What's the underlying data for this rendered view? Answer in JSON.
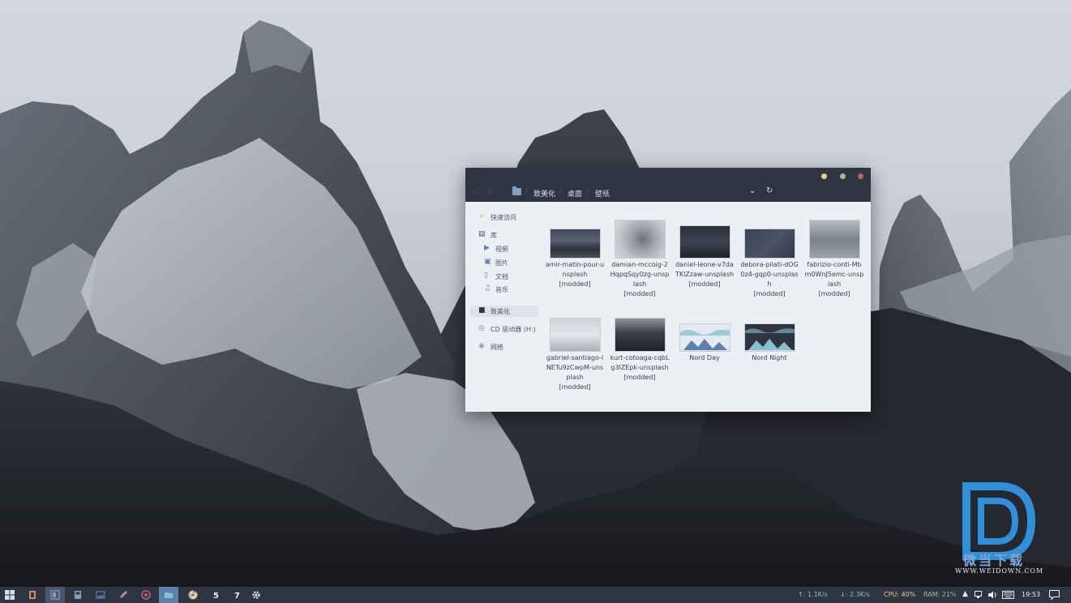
{
  "window": {
    "breadcrumb": [
      "致美化",
      "桌面",
      "壁纸"
    ]
  },
  "sidebar": {
    "quick_access": "快速访问",
    "library": "库",
    "videos": "视频",
    "pictures": "图片",
    "documents": "文档",
    "music": "音乐",
    "this_pc": "致美化",
    "cd_drive": "CD 驱动器 (H:)",
    "network": "网络"
  },
  "files": [
    {
      "name": "amir-matin-pour-unsplash",
      "tag": "[modded]"
    },
    {
      "name": "damian-mccoig-2HqpqSqy0zg-unsplash",
      "tag": "[modded]"
    },
    {
      "name": "daniel-leone-v7daTKlZzaw-unsplash",
      "tag": "[modded]"
    },
    {
      "name": "debora-pilati-dOG0z4-gqp0-unsplash",
      "tag": "[modded]"
    },
    {
      "name": "fabrizio-conti-Mbm0WnJ5emc-unsplash",
      "tag": "[modded]"
    },
    {
      "name": "gabriel-santiago-lNETu9zCwpM-unsplash",
      "tag": "[modded]"
    },
    {
      "name": "kurt-cotoaga-cqbLg3lZEpk-unsplash",
      "tag": "[modded]"
    },
    {
      "name": "Nord Day",
      "tag": ""
    },
    {
      "name": "Nord Night",
      "tag": ""
    }
  ],
  "taskbar": {
    "upload": "↑: 1.1K/s",
    "download": "↓: 2.3K/s",
    "cpu": "CPU: 40%",
    "ram": "RAM: 21%",
    "clock": "19:53",
    "app_icons": [
      "windows-start",
      "office",
      "file-manager",
      "save",
      "image-viewer",
      "pen",
      "netease-music",
      "folder",
      "chrome",
      "s-app",
      "one-app",
      "settings"
    ]
  },
  "watermark": {
    "text": "微当下载",
    "url": "WWW.WEIDOWN.COM"
  },
  "colors": {
    "nord_dark": "#2e3440",
    "nord_light": "#eceff4",
    "accent_blue": "#5e81ac",
    "close": "#bf616a",
    "minimize": "#ebcb8b",
    "maximize": "#a3be8c",
    "upload": "#88c0d0",
    "download": "#88c0d0",
    "cpu": "#ebcb8b",
    "ram": "#a3be8c"
  }
}
